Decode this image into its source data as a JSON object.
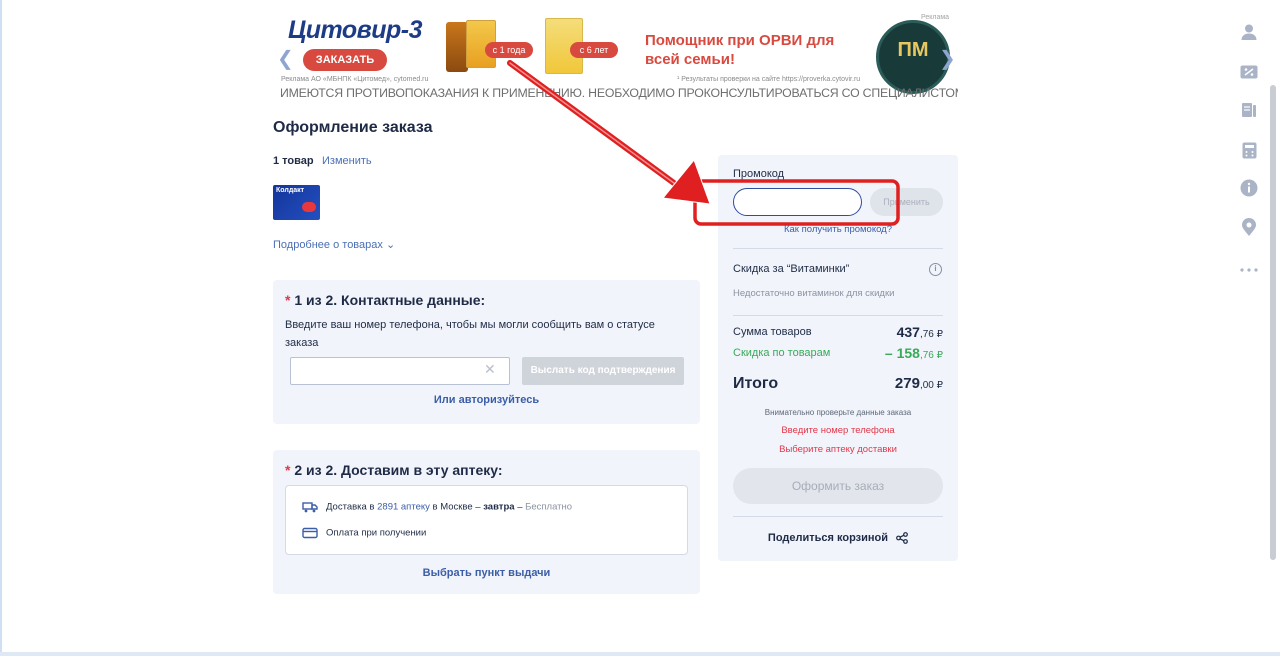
{
  "banner": {
    "logo": "Цитовир-3",
    "order_button": "ЗАКАЗАТЬ",
    "age_small": "с 1 года",
    "age_big": "с 6 лет",
    "slogan": "Помощник при ОРВИ для всей семьи!",
    "ad_label": "Реклама",
    "legal_left": "Реклама АО «МБНПК «Цитомед», cytomed.ru",
    "legal_right": "¹ Результаты проверки на сайте https://proverka.cytovir.ru",
    "badge_text": "ПМ",
    "warning": "ИМЕЮТСЯ ПРОТИВОПОКАЗАНИЯ К ПРИМЕНЕНИЮ. НЕОБХОДИМО ПРОКОНСУЛЬТИРОВАТЬСЯ СО СПЕЦИАЛИСТОМ"
  },
  "order": {
    "title": "Оформление заказа",
    "items_count": "1 товар",
    "change_link": "Изменить",
    "product_name": "Колдакт",
    "more_link": "Подробнее о товарах ⌄"
  },
  "contact": {
    "required_mark": "*",
    "title": "1 из 2. Контактные данные:",
    "description": "Введите ваш номер телефона, чтобы мы могли сообщить вам о статусе заказа",
    "phone_value": "",
    "clear_glyph": "✕",
    "send_code_button": "Выслать код подтверждения",
    "auth_link": "Или авторизуйтесь"
  },
  "delivery": {
    "required_mark": "*",
    "title": "2 из 2. Доставим в эту аптеку:",
    "line1_prefix": "Доставка в",
    "line1_link": "2891 аптеку",
    "line1_mid": "в Москве –",
    "line1_bold": "завтра",
    "line1_dash": "–",
    "line1_muted": "Бесплатно",
    "line2": "Оплата при получении",
    "pickup_link": "Выбрать пункт выдачи"
  },
  "summary": {
    "promo_label": "Промокод",
    "promo_value": "",
    "promo_apply": "Применить",
    "promo_how": "Как получить промокод?",
    "vitamins_title": "Скидка за “Витаминки”",
    "vitamins_note": "Недостаточно витаминок для скидки",
    "sum_label": "Сумма товаров",
    "sum_int": "437",
    "sum_frac": ",76 ₽",
    "discount_label": "Скидка по товарам",
    "discount_int": "– 158",
    "discount_frac": ",76 ₽",
    "total_label": "Итого",
    "total_int": "279",
    "total_frac": ",00 ₽",
    "check_note": "Внимательно проверьте данные заказа",
    "error_phone": "Введите номер телефона",
    "error_pharmacy": "Выберите аптеку доставки",
    "place_order": "Оформить заказ",
    "share": "Поделиться корзиной"
  },
  "rail": [
    "user-icon",
    "discount-icon",
    "catalog-icon",
    "calculator-icon",
    "info-icon",
    "location-icon",
    "more-icon"
  ],
  "colors": {
    "accent": "#3c5ea8",
    "error": "#e2374a",
    "success": "#3aa95a",
    "annotation": "#e02020"
  }
}
